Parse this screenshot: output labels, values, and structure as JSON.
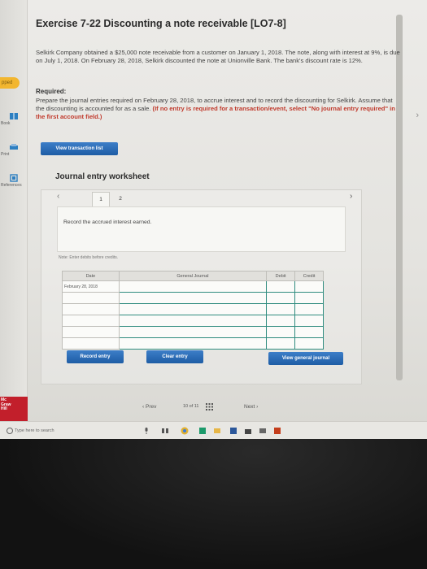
{
  "exercise": {
    "title": "Exercise 7-22 Discounting a note receivable [LO7-8]",
    "problem": "Selkirk Company obtained a $25,000 note receivable from a customer on January 1, 2018. The note, along with interest at 9%, is due on July 1, 2018. On February 28, 2018, Selkirk discounted the note at Unionville Bank. The bank's discount rate is 12%.",
    "required_heading": "Required:",
    "required_text": "Prepare the journal entries required on February 28, 2018, to accrue interest and to record the discounting for Selkirk. Assume that the discounting is accounted for as a sale.",
    "required_note": "(If no entry is required for a transaction/event, select \"No journal entry required\" in the first account field.)"
  },
  "buttons": {
    "view_transaction_list": "View transaction list",
    "record_entry": "Record entry",
    "clear_entry": "Clear entry",
    "view_general_journal": "View general journal"
  },
  "worksheet": {
    "title": "Journal entry worksheet",
    "tabs": [
      "1",
      "2"
    ],
    "instruction": "Record the accrued interest earned.",
    "note": "Note: Enter debits before credits.",
    "columns": {
      "date": "Date",
      "account": "General Journal",
      "debit": "Debit",
      "credit": "Credit"
    },
    "rows": [
      {
        "date": "February 28, 2018"
      },
      {
        "date": ""
      },
      {
        "date": ""
      },
      {
        "date": ""
      },
      {
        "date": ""
      },
      {
        "date": ""
      }
    ]
  },
  "pager": {
    "prev": "Prev",
    "current": "10",
    "of": "of",
    "total": "11",
    "next": "Next"
  },
  "left_rail": {
    "badge": "pped",
    "items": [
      "Book",
      "Print",
      "References"
    ]
  },
  "logo": {
    "lines": [
      "Mc",
      "Graw",
      "Hill"
    ]
  },
  "taskbar": {
    "search_placeholder": "Type here to search"
  },
  "colors": {
    "button_blue": "#2a6bb5",
    "required_red": "#c0392b",
    "table_border": "#2f8c7f",
    "logo_red": "#c21f2b"
  }
}
